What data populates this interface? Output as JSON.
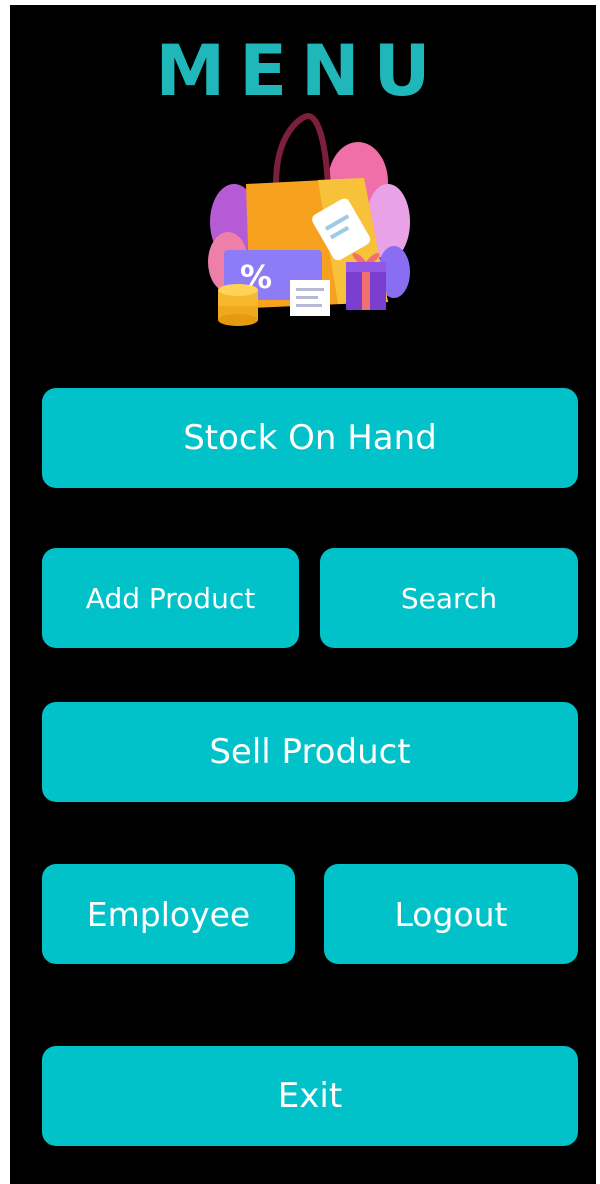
{
  "header": {
    "title": "MENU"
  },
  "illustration": {
    "icon": "shopping-bag-illustration",
    "badge_text": "%"
  },
  "buttons": {
    "stock_on_hand": "Stock On Hand",
    "add_product": "Add Product",
    "search": "Search",
    "sell_product": "Sell Product",
    "employee": "Employee",
    "logout": "Logout",
    "exit": "Exit"
  },
  "colors": {
    "background": "#000000",
    "title": "#1fb7b9",
    "button": "#00c2c8",
    "button_text": "#ffffff"
  }
}
